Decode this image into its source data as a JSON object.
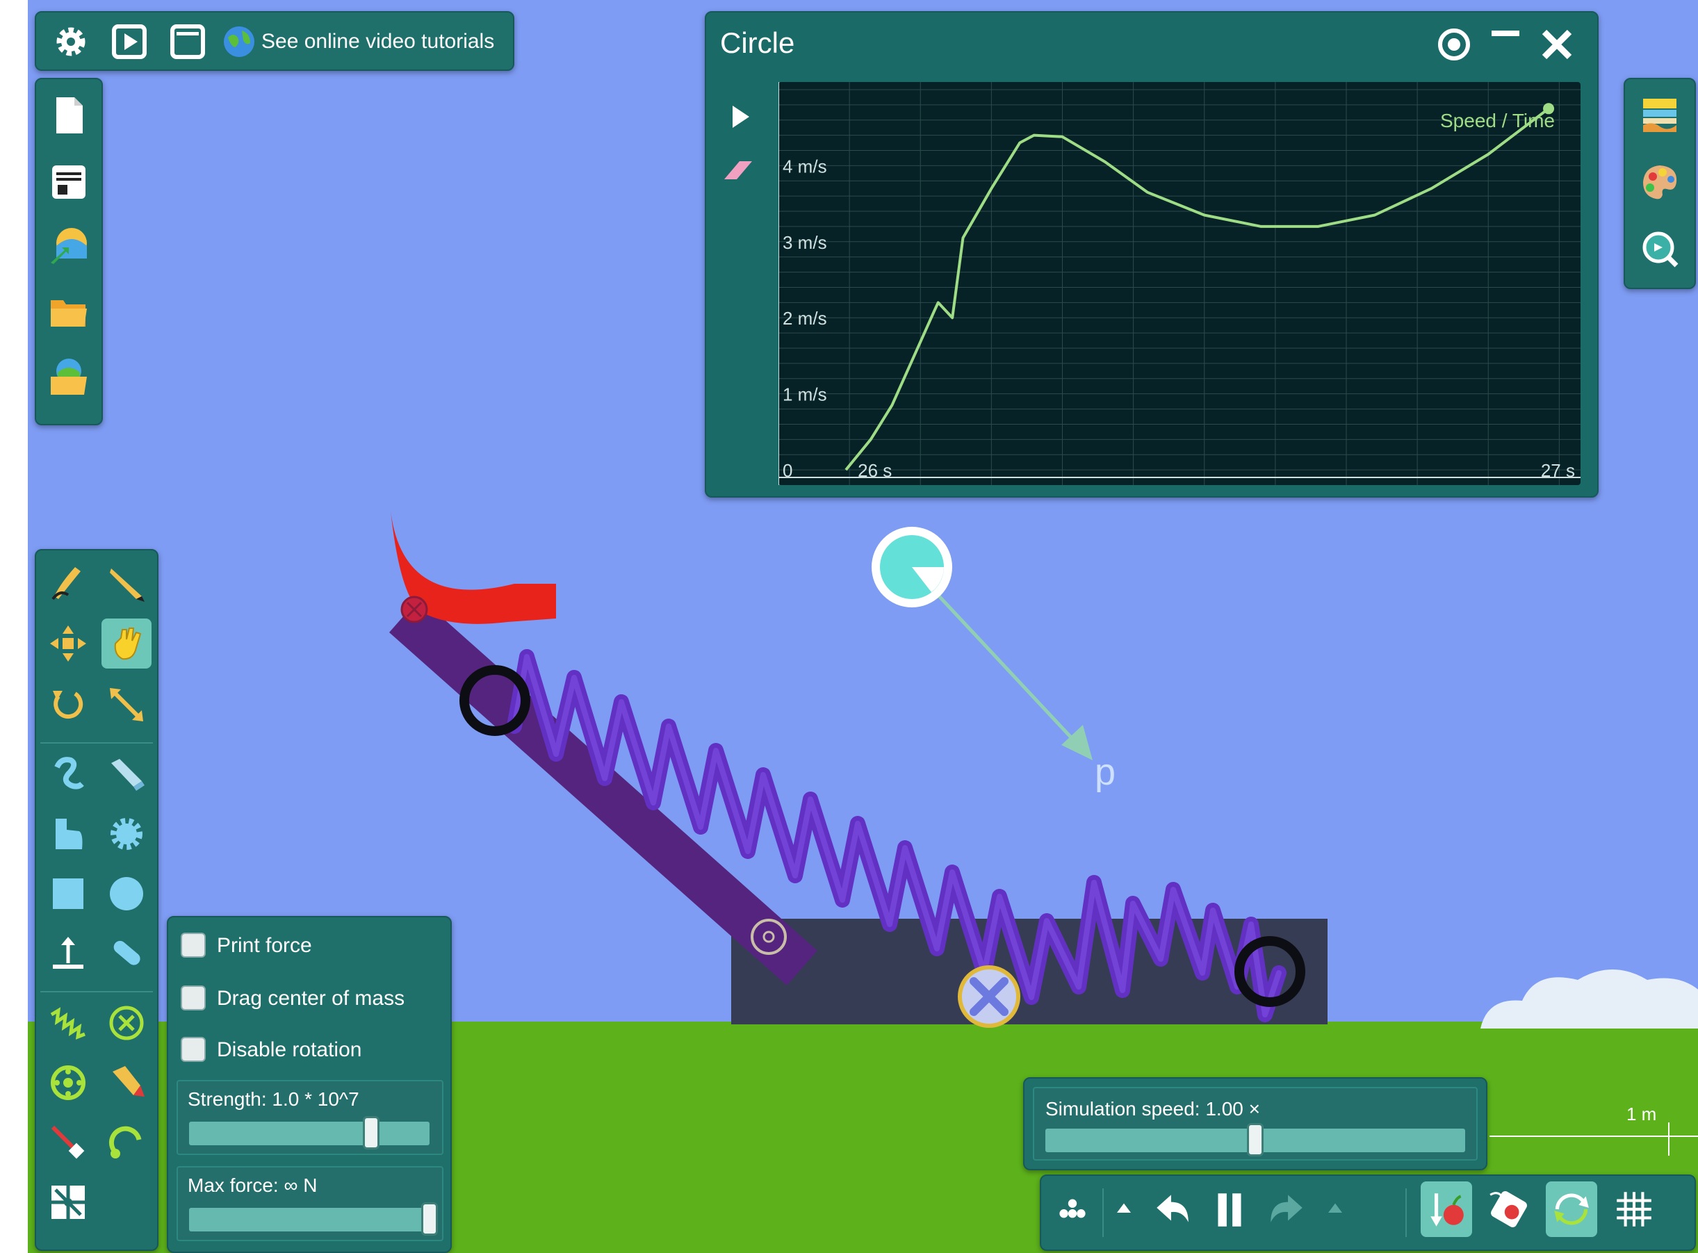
{
  "top_bar": {
    "settings_icon": "gear-icon",
    "play_icon": "play-box-icon",
    "window_icon": "window-icon",
    "tutorials_icon": "globe-icon",
    "tutorials_label": "See online video tutorials"
  },
  "file_toolbar": {
    "items": [
      "new-file-icon",
      "print-icon",
      "export-image-icon",
      "open-folder-icon",
      "open-scene-icon"
    ]
  },
  "graph": {
    "title": "Circle",
    "legend": "Speed / Time",
    "y_tick_labels": [
      "4 m/s",
      "3 m/s",
      "2 m/s",
      "1 m/s",
      "0"
    ],
    "x_tick_labels": [
      "26 s",
      "27 s"
    ],
    "line_color": "#9fdc86"
  },
  "chart_data": {
    "type": "line",
    "title": "Circle",
    "legend": [
      "Speed / Time"
    ],
    "xlabel": "",
    "ylabel": "",
    "x_tick_labels": [
      "26 s",
      "27 s"
    ],
    "y_tick_labels": [
      "0",
      "1 m/s",
      "2 m/s",
      "3 m/s",
      "4 m/s"
    ],
    "xlim": [
      25.9,
      27.03
    ],
    "ylim": [
      -0.2,
      5.1
    ],
    "grid": true,
    "series": [
      {
        "name": "Speed / Time",
        "x": [
          25.995,
          26.03,
          26.06,
          26.12,
          26.125,
          26.145,
          26.16,
          26.2,
          26.24,
          26.26,
          26.3,
          26.36,
          26.42,
          26.5,
          26.58,
          26.66,
          26.74,
          26.82,
          26.9,
          26.985
        ],
        "y": [
          0.0,
          0.4,
          0.85,
          2.1,
          2.2,
          2.0,
          3.05,
          3.7,
          4.3,
          4.4,
          4.38,
          4.05,
          3.65,
          3.35,
          3.2,
          3.2,
          3.35,
          3.7,
          4.15,
          4.75
        ]
      }
    ]
  },
  "scene": {
    "momentum_label": "p",
    "scale_label": "1 m"
  },
  "properties": {
    "print_force": "Print force",
    "drag_center": "Drag center of mass",
    "disable_rotation": "Disable rotation",
    "strength": "Strength:  1.0 * 10^7",
    "max_force": "Max force:  ∞  N",
    "strength_level": 0.8,
    "max_force_level": 1.0
  },
  "sim_speed": {
    "label": "Simulation speed:  1.00 ×",
    "level": 0.5
  },
  "bottom_bar": {
    "items": [
      "pressure-icon",
      "undo-up-arrow-icon",
      "undo-icon",
      "pause-icon",
      "redo-icon",
      "redo-up-arrow-icon",
      "gravity-icon",
      "air-resistance-icon",
      "rotate-view-icon",
      "grid-icon"
    ]
  },
  "right_toolbar": {
    "items": [
      "background-icon",
      "palette-icon",
      "zoom-icon"
    ]
  },
  "tools": {
    "items": [
      "brush-icon",
      "knife-icon",
      "move-icon",
      "drag-hand-icon",
      "rotate-icon",
      "scale-icon",
      "rope-icon",
      "eraser-icon",
      "polygon-icon",
      "gear-shape-icon",
      "box-icon",
      "circle-icon",
      "plane-icon",
      "chain-icon",
      "spring-icon",
      "fixjoint-icon",
      "hinge-icon",
      "tracer-icon",
      "laser-icon",
      "thruster-icon",
      "fan-icon"
    ]
  }
}
